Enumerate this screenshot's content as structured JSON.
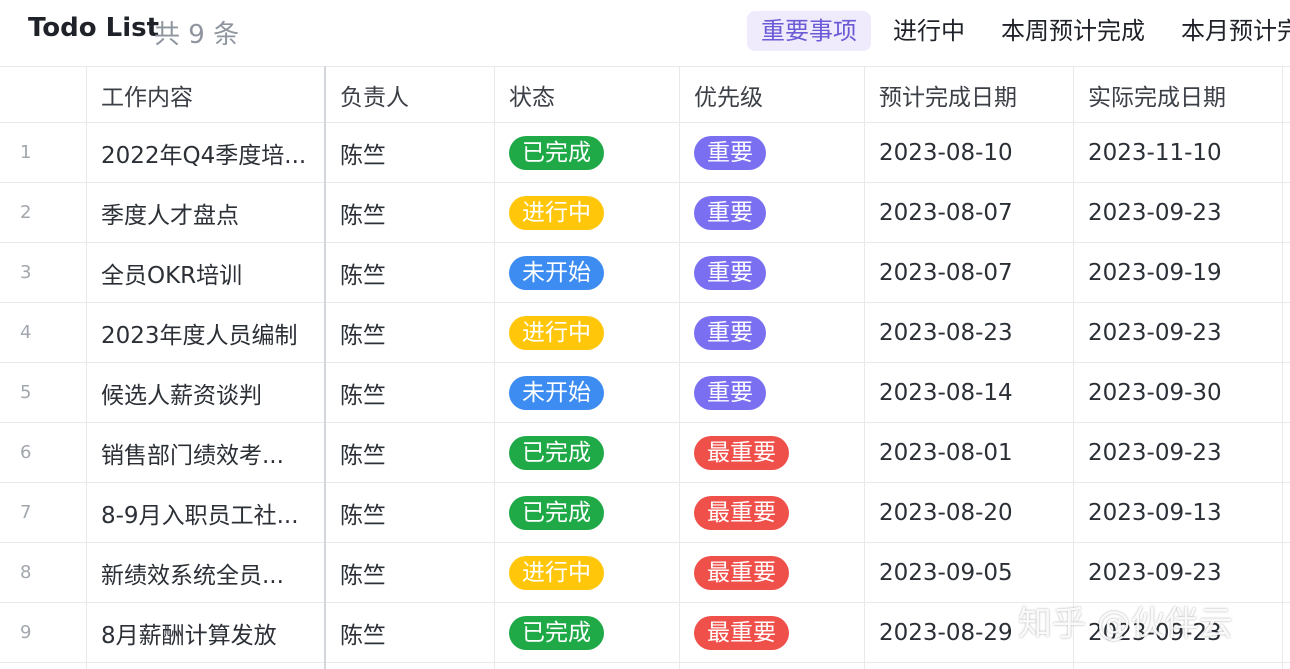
{
  "header": {
    "title": "Todo List",
    "count_text": "共 9 条",
    "views": [
      {
        "label": "重要事项",
        "active": true
      },
      {
        "label": "进行中",
        "active": false
      },
      {
        "label": "本周预计完成",
        "active": false
      },
      {
        "label": "本月预计完",
        "active": false
      }
    ]
  },
  "table": {
    "columns": [
      "",
      "工作内容",
      "负责人",
      "状态",
      "优先级",
      "预计完成日期",
      "实际完成日期"
    ],
    "rows": [
      {
        "index": "1",
        "task": "2022年Q4季度培...",
        "owner": "陈竺",
        "status": "已完成",
        "priority": "重要",
        "planned": "2023-08-10",
        "actual": "2023-11-10"
      },
      {
        "index": "2",
        "task": "季度人才盘点",
        "owner": "陈竺",
        "status": "进行中",
        "priority": "重要",
        "planned": "2023-08-07",
        "actual": "2023-09-23"
      },
      {
        "index": "3",
        "task": "全员OKR培训",
        "owner": "陈竺",
        "status": "未开始",
        "priority": "重要",
        "planned": "2023-08-07",
        "actual": "2023-09-19"
      },
      {
        "index": "4",
        "task": "2023年度人员编制",
        "owner": "陈竺",
        "status": "进行中",
        "priority": "重要",
        "planned": "2023-08-23",
        "actual": "2023-09-23"
      },
      {
        "index": "5",
        "task": "候选人薪资谈判",
        "owner": "陈竺",
        "status": "未开始",
        "priority": "重要",
        "planned": "2023-08-14",
        "actual": "2023-09-30"
      },
      {
        "index": "6",
        "task": "销售部门绩效考...",
        "owner": "陈竺",
        "status": "已完成",
        "priority": "最重要",
        "planned": "2023-08-01",
        "actual": "2023-09-23"
      },
      {
        "index": "7",
        "task": "8-9月入职员工社...",
        "owner": "陈竺",
        "status": "已完成",
        "priority": "最重要",
        "planned": "2023-08-20",
        "actual": "2023-09-13"
      },
      {
        "index": "8",
        "task": "新绩效系统全员...",
        "owner": "陈竺",
        "status": "进行中",
        "priority": "最重要",
        "planned": "2023-09-05",
        "actual": "2023-09-23"
      },
      {
        "index": "9",
        "task": "8月薪酬计算发放",
        "owner": "陈竺",
        "status": "已完成",
        "priority": "最重要",
        "planned": "2023-08-29",
        "actual": "2023-09-23"
      }
    ]
  },
  "tag_colors": {
    "已完成": "#1fa947",
    "进行中": "#ffc60a",
    "未开始": "#3c8cf2",
    "重要": "#7a6ff0",
    "最重要": "#f0504a"
  },
  "watermark": "知乎 @伙伴云"
}
